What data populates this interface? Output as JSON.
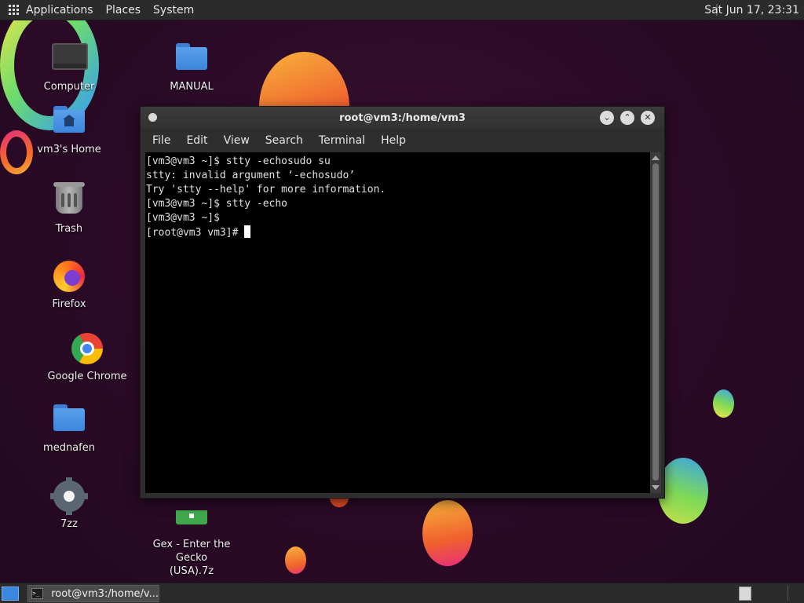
{
  "top_panel": {
    "menus": [
      "Applications",
      "Places",
      "System"
    ],
    "clock": "Sat Jun 17, 23:31"
  },
  "desktop_icons": [
    {
      "label": "Computer",
      "icon": "computer-icon"
    },
    {
      "label": "MANUAL",
      "icon": "folder-icon"
    },
    {
      "label": "vm3's Home",
      "icon": "home-folder-icon"
    },
    {
      "label": "Trash",
      "icon": "trash-icon"
    },
    {
      "label": "Firefox",
      "icon": "firefox-icon"
    },
    {
      "label": "Google Chrome",
      "icon": "chrome-icon"
    },
    {
      "label": "mednafen",
      "icon": "folder-icon"
    },
    {
      "label": "7zz",
      "icon": "gear-icon"
    },
    {
      "label": "Gex - Enter the Gecko\n(USA).7z",
      "icon": "archive-icon"
    }
  ],
  "terminal": {
    "title": "root@vm3:/home/vm3",
    "menu": [
      "File",
      "Edit",
      "View",
      "Search",
      "Terminal",
      "Help"
    ],
    "lines": [
      "[vm3@vm3 ~]$ stty -echosudo su",
      "stty: invalid argument ‘-echosudo’",
      "Try 'stty --help' for more information.",
      "[vm3@vm3 ~]$ stty -echo",
      "[vm3@vm3 ~]$ ",
      "[root@vm3 vm3]# "
    ]
  },
  "taskbar": {
    "task_label": "root@vm3:/home/v...",
    "task_icon_glyph": ">_"
  },
  "colors": {
    "panel": "#2b2b2b",
    "wallpaper": "#2a0a26",
    "terminal_bg": "#000000",
    "folder_blue": "#3b86de"
  }
}
